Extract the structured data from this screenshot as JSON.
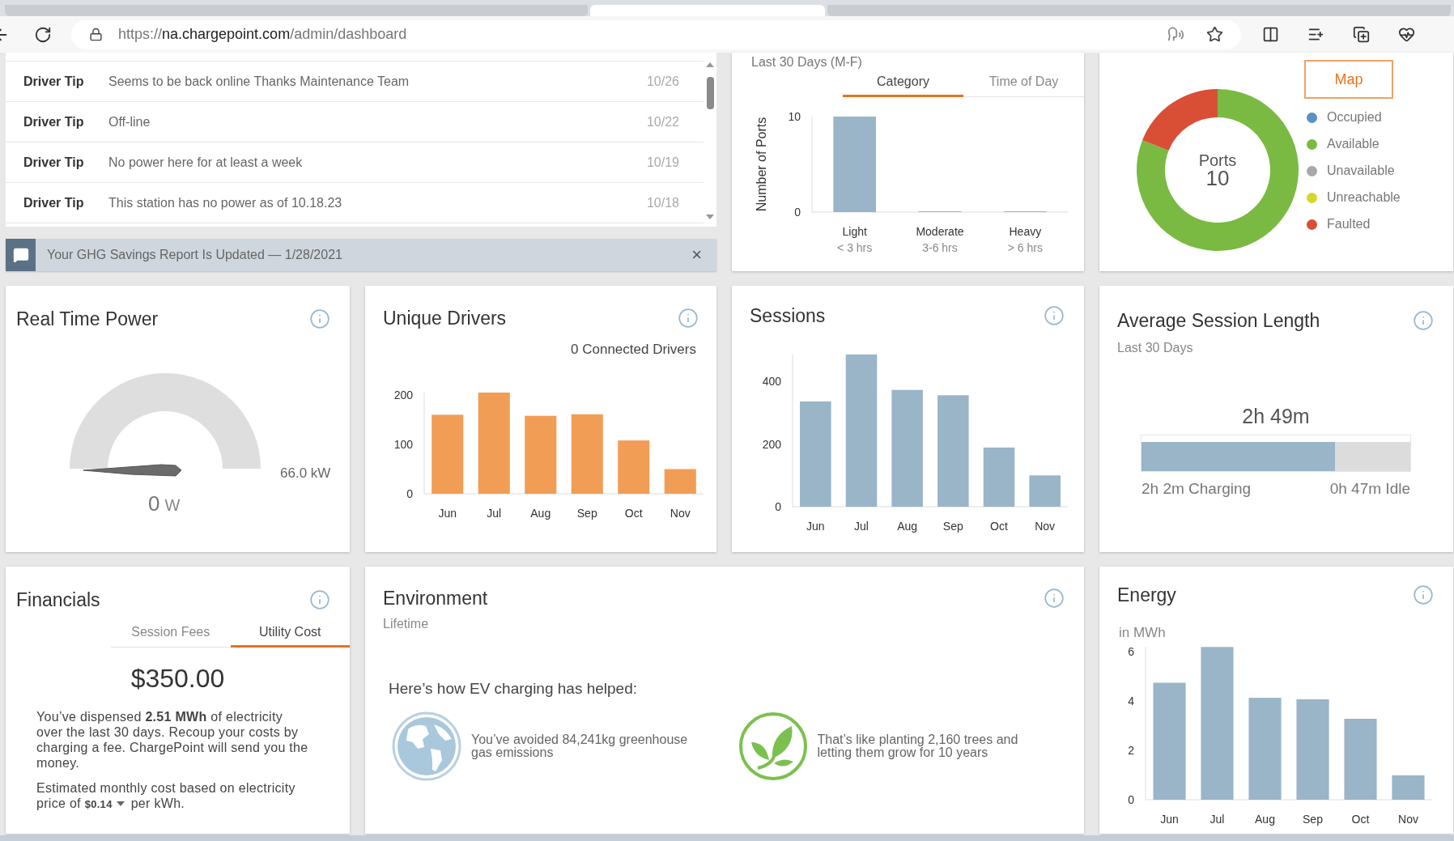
{
  "browser": {
    "tabs": [
      {
        "selected": false
      },
      {
        "selected": true
      },
      {
        "selected": false
      }
    ],
    "url": {
      "scheme": "https://",
      "host": "na.chargepoint.com",
      "path": "/admin/dashboard"
    }
  },
  "tips": {
    "rows": [
      {
        "type": "Driver Tip",
        "message": "Seems to be back online Thanks Maintenance Team",
        "date": "10/26"
      },
      {
        "type": "Driver Tip",
        "message": "Off-line",
        "date": "10/22"
      },
      {
        "type": "Driver Tip",
        "message": "No power here for at least a week",
        "date": "10/19"
      },
      {
        "type": "Driver Tip",
        "message": "This station has no power as of 10.18.23",
        "date": "10/18"
      }
    ]
  },
  "notification": {
    "text": "Your GHG Savings Report Is Updated — 1/28/2021",
    "close": "×"
  },
  "port_usage": {
    "subtitle": "Last 30 Days (M-F)",
    "tabs": [
      {
        "label": "Category",
        "selected": true
      },
      {
        "label": "Time of Day",
        "selected": false
      }
    ],
    "category_notes": [
      "< 3 hrs",
      "3-6 hrs",
      "> 6 hrs"
    ],
    "chart_data": {
      "type": "bar",
      "ylabel": "Number of Ports",
      "categories": [
        "Light",
        "Moderate",
        "Heavy"
      ],
      "values": [
        10,
        0,
        0
      ],
      "yticks": [
        0,
        10
      ],
      "ylim": [
        0,
        10
      ]
    }
  },
  "port_status": {
    "button": "Map",
    "center_label": "Ports",
    "center_value": "10",
    "legend": [
      {
        "label": "Occupied",
        "color": "#5b8fc7"
      },
      {
        "label": "Available",
        "color": "#7aba42"
      },
      {
        "label": "Unavailable",
        "color": "#a8a8a8"
      },
      {
        "label": "Unreachable",
        "color": "#d6d62c"
      },
      {
        "label": "Faulted",
        "color": "#d84f36"
      }
    ]
  },
  "real_time_power": {
    "title": "Real Time Power",
    "value": "0",
    "unit": "W",
    "max": "66.0 kW"
  },
  "unique_drivers": {
    "title": "Unique Drivers",
    "note": "0 Connected Drivers",
    "chart_data": {
      "type": "bar",
      "categories": [
        "Jun",
        "Jul",
        "Aug",
        "Sep",
        "Oct",
        "Nov"
      ],
      "values": [
        160,
        205,
        158,
        161,
        108,
        50
      ],
      "yticks": [
        0,
        100,
        200
      ],
      "ylim": [
        0,
        205
      ]
    }
  },
  "sessions": {
    "title": "Sessions",
    "chart_data": {
      "type": "bar",
      "categories": [
        "Jun",
        "Jul",
        "Aug",
        "Sep",
        "Oct",
        "Nov"
      ],
      "values": [
        336,
        486,
        373,
        356,
        189,
        100
      ],
      "yticks": [
        0,
        200,
        400
      ],
      "ylim": [
        0,
        486
      ]
    }
  },
  "avg_session": {
    "title": "Average Session Length",
    "subtitle": "Last 30 Days",
    "total": "2h 49m",
    "level": 0.72,
    "charging": "2h 2m Charging",
    "idle": "0h 47m Idle"
  },
  "financials": {
    "title": "Financials",
    "tabs": [
      {
        "label": "Session Fees",
        "selected": false
      },
      {
        "label": "Utility Cost",
        "selected": true
      }
    ],
    "amount": "$350.00",
    "summary": "You’ve dispensed **2.51 MWh** of electricity over the last 30 days. Recoup your costs by charging a fee. ChargePoint will send you the money.",
    "estimate_before": "Estimated monthly cost based on electricity price of",
    "price": "$0.14",
    "estimate_after": "per kWh."
  },
  "environment": {
    "title": "Environment",
    "subtitle": "Lifetime",
    "heading": "Here’s how EV charging has helped:",
    "facts": [
      {
        "kind": "globe",
        "text": "You’ve avoided 84,241kg greenhouse gas emissions"
      },
      {
        "kind": "leaf",
        "text": "That’s like planting 2,160 trees and letting them grow for 10 years"
      }
    ]
  },
  "energy": {
    "title": "Energy",
    "unit_label": "in MWh",
    "chart_data": {
      "type": "bar",
      "categories": [
        "Jun",
        "Jul",
        "Aug",
        "Sep",
        "Oct",
        "Nov"
      ],
      "values": [
        4.74,
        6.19,
        4.13,
        4.07,
        3.28,
        0.99
      ],
      "yticks": [
        0,
        2,
        4,
        6
      ],
      "ylim": [
        0,
        6.2
      ]
    }
  }
}
